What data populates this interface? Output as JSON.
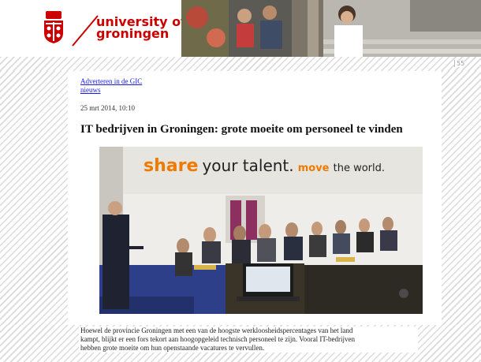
{
  "header": {
    "logo_line1": "university of",
    "logo_line2": "groningen",
    "brand_color": "#cc0000",
    "crest_icon": "university-crest-icon"
  },
  "slide": {
    "page_number": "55"
  },
  "article": {
    "breadcrumb_line1": "Adverteren in de GIC",
    "breadcrumb_line2": "nieuws",
    "date": "25 mrt 2014, 10:10",
    "title": "IT bedrijven in Groningen: grote moeite om personeel te vinden",
    "poster_word1": "share",
    "poster_word2": "your talent.",
    "poster_word3": "move",
    "poster_word4": "the world.",
    "body_line1": "Hoewel de provincie Groningen met een van de hoogste werkloosheidspercentages van het land",
    "body_line2": "kampt, blijkt er een fors tekort aan hoogopgeleid technisch personeel te zijn. Vooral IT-bedrijven",
    "body_line3": "hebben grote moeite om hun openstaande vacatures te vervullen."
  }
}
